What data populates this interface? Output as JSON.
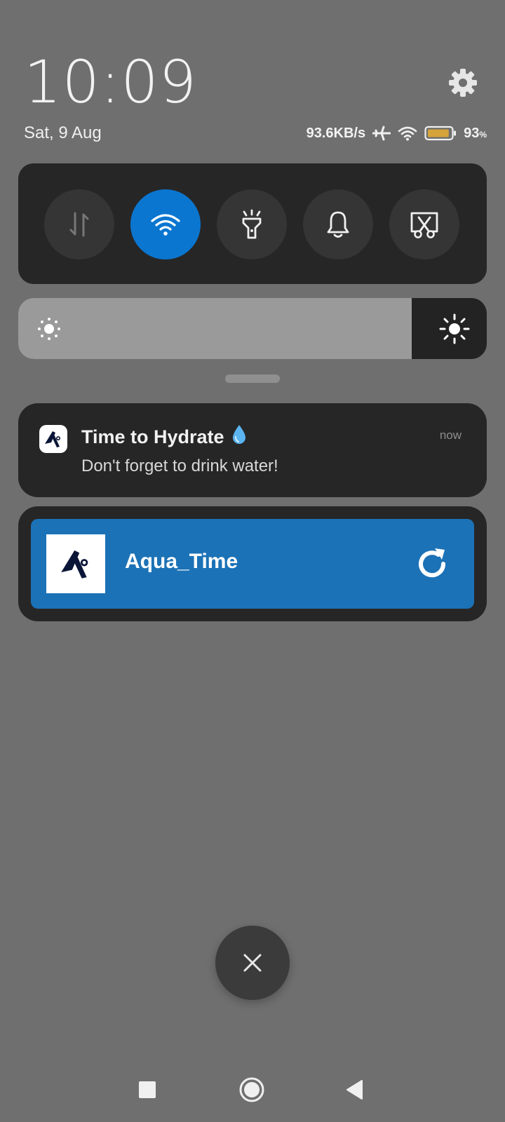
{
  "header": {
    "time": "10:09",
    "date": "Sat, 9 Aug"
  },
  "status": {
    "network_speed": "93.6KB/s",
    "battery_percent": "93",
    "battery_unit": "%",
    "battery_level": 0.93,
    "icons": [
      "airplane-icon",
      "wifi-icon",
      "battery-icon"
    ]
  },
  "quick_toggles": [
    {
      "name": "mobile-data",
      "active": false
    },
    {
      "name": "wifi",
      "active": true
    },
    {
      "name": "flashlight",
      "active": false
    },
    {
      "name": "sound",
      "active": false
    },
    {
      "name": "screenshot",
      "active": false
    }
  ],
  "brightness": {
    "level": 0.84
  },
  "notification": {
    "title": "Time to Hydrate",
    "emoji": "💧",
    "time": "now",
    "body": "Don't forget to drink water!"
  },
  "widget": {
    "app_name": "Aqua_Time"
  },
  "colors": {
    "background": "#6f6f6f",
    "panel": "#262627",
    "accent_blue": "#0b76d0",
    "widget_blue": "#1c72b6",
    "battery_fill": "#d4a33a"
  }
}
